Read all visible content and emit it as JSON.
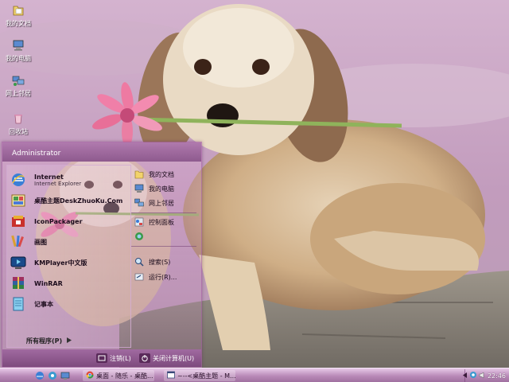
{
  "desktop": {
    "icons": [
      {
        "label": "我的文档",
        "icon": "my-documents-icon"
      },
      {
        "label": "我的电脑",
        "icon": "my-computer-icon"
      },
      {
        "label": "网上邻居",
        "icon": "network-places-icon"
      },
      {
        "label": "回收站",
        "icon": "recycle-bin-icon"
      }
    ]
  },
  "start_menu": {
    "user": "Administrator",
    "programs": [
      {
        "name": "Internet",
        "sub": "Internet Explorer",
        "icon": "internet-explorer-icon"
      },
      {
        "name": "桌酷主题DeskZhuoKu.Com",
        "sub": "",
        "icon": "deskzhuoku-icon"
      },
      {
        "name": "IconPackager",
        "sub": "",
        "icon": "iconpackager-icon"
      },
      {
        "name": "画图",
        "sub": "",
        "icon": "paint-icon"
      },
      {
        "name": "KMPlayer中文版",
        "sub": "",
        "icon": "kmplayer-icon"
      },
      {
        "name": "WinRAR",
        "sub": "",
        "icon": "winrar-icon"
      },
      {
        "name": "记事本",
        "sub": "",
        "icon": "notepad-icon"
      }
    ],
    "all_programs": "所有程序(P)",
    "places": [
      {
        "label": "我的文档",
        "icon": "my-documents-icon"
      },
      {
        "label": "我的电脑",
        "icon": "my-computer-icon"
      },
      {
        "label": "网上邻居",
        "icon": "network-places-icon"
      },
      {
        "label": "控制面板",
        "icon": "control-panel-icon"
      },
      {
        "label": "",
        "icon": "printers-icon"
      },
      {
        "label": "搜索(S)",
        "icon": "search-icon"
      },
      {
        "label": "运行(R)...",
        "icon": "run-icon"
      }
    ],
    "logoff": "注销(L)",
    "shutdown": "关闭计算机(U)"
  },
  "taskbar": {
    "quick_launch": [
      "ie-icon",
      "explorer-icon",
      "desktop-icon"
    ],
    "tasks": [
      {
        "label": "桌面 - 随乐 - 桌酷...",
        "icon": "chrome-icon"
      },
      {
        "label": "~--<桌酷主题 - M...",
        "icon": "window-icon"
      }
    ],
    "clock": "22:46"
  },
  "colors": {
    "accent": "#9a5f9a",
    "taskbar": "#b98ab8",
    "menu_header": "#8e5a8e"
  }
}
